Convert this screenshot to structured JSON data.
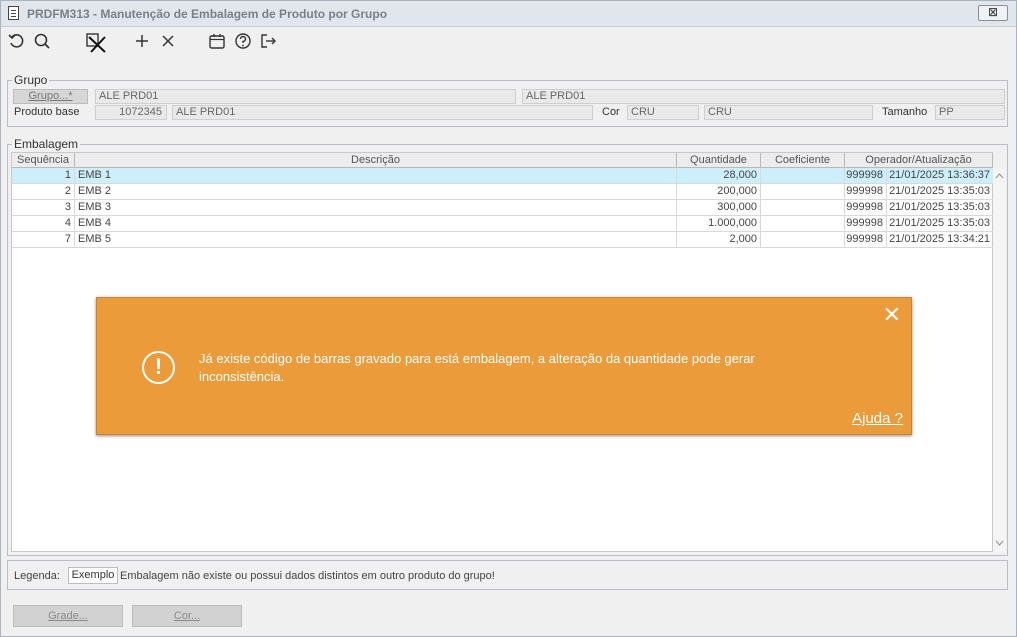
{
  "window": {
    "title": "PRDFM313 - Manutenção de Embalagem de Produto por Grupo",
    "close_glyph": "⊠"
  },
  "toolbar": {
    "icons": [
      "undo-icon",
      "search-icon",
      "cancel-record-icon",
      "add-icon",
      "delete-icon",
      "calendar-icon",
      "help-icon",
      "exit-icon"
    ]
  },
  "grupo_section": {
    "legend": "Grupo",
    "grupo_button": "Grupo...*",
    "grupo_code": "ALE PRD01",
    "grupo_desc": "ALE PRD01",
    "produto_base_label": "Produto base",
    "produto_base_code": "1072345",
    "produto_base_desc": "ALE PRD01",
    "cor_label": "Cor",
    "cor_code": "CRU",
    "cor_desc": "CRU",
    "tamanho_label": "Tamanho",
    "tamanho_value": "PP"
  },
  "embalagem_section": {
    "legend": "Embalagem",
    "columns": [
      "Sequência",
      "Descrição",
      "Quantidade",
      "Coeficiente",
      "Operador/Atualização"
    ],
    "rows": [
      {
        "seq": "1",
        "desc": "EMB 1",
        "qtd": "28,000",
        "coef": "",
        "operador": "999998",
        "data": "21/01/2025 13:36:37",
        "selected": true
      },
      {
        "seq": "2",
        "desc": "EMB 2",
        "qtd": "200,000",
        "coef": "",
        "operador": "999998",
        "data": "21/01/2025 13:35:03",
        "selected": false
      },
      {
        "seq": "3",
        "desc": "EMB 3",
        "qtd": "300,000",
        "coef": "",
        "operador": "999998",
        "data": "21/01/2025 13:35:03",
        "selected": false
      },
      {
        "seq": "4",
        "desc": "EMB 4",
        "qtd": "1.000,000",
        "coef": "",
        "operador": "999998",
        "data": "21/01/2025 13:35:03",
        "selected": false
      },
      {
        "seq": "7",
        "desc": "EMB 5",
        "qtd": "2,000",
        "coef": "",
        "operador": "999998",
        "data": "21/01/2025 13:34:21",
        "selected": false
      }
    ]
  },
  "legenda": {
    "label": "Legenda:",
    "sample": "Exemplo",
    "description": "Embalagem não existe ou possui dados distintos em outro produto do grupo!"
  },
  "footer": {
    "grade_button": "Grade...",
    "cor_button": "Cor..."
  },
  "toast": {
    "message": "Já existe código de barras gravado para está embalagem, a alteração da quantidade pode gerar inconsistência.",
    "help_link": "Ajuda ?",
    "icon_glyph": "!",
    "close_glyph": "✕",
    "background": "#ec9b3b"
  },
  "colors": {
    "selected_row": "#cdeefb",
    "titlebar": "#e1e6ed"
  }
}
